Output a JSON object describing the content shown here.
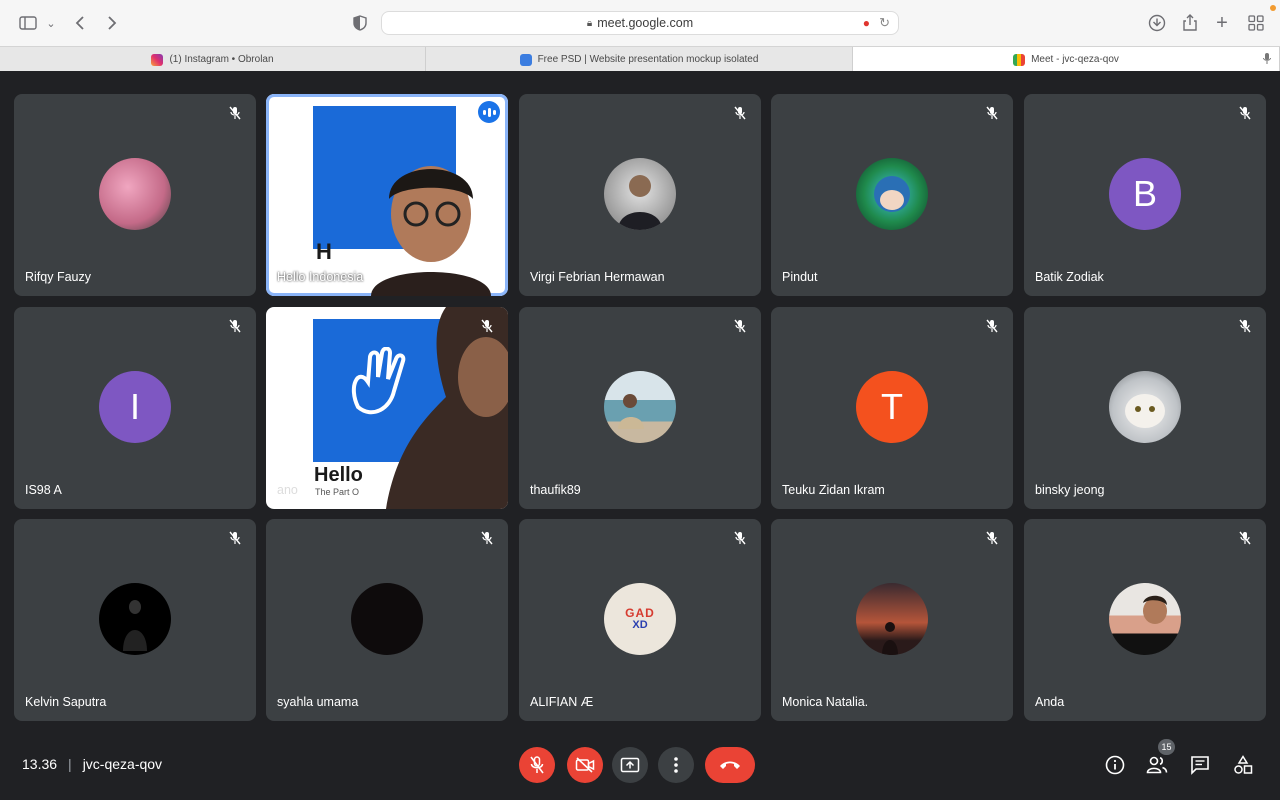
{
  "browser": {
    "url": "meet.google.com",
    "tabs": [
      {
        "label": "(1) Instagram • Obrolan"
      },
      {
        "label": "Free PSD | Website presentation mockup isolated"
      },
      {
        "label": "Meet - jvc-qeza-qov"
      }
    ]
  },
  "participants": [
    {
      "name": "Rifqy Fauzy",
      "avatar_color": "#d87fa0"
    },
    {
      "name": "Hello Indonesia",
      "sign_text": "H"
    },
    {
      "name": "Virgi Febrian Hermawan",
      "avatar_color": "#c9c9c9"
    },
    {
      "name": "Pindut",
      "avatar_color": "#1f8a4c"
    },
    {
      "name": "Batik Zodiak",
      "initial": "B",
      "avatar_color": "#7e57c2"
    },
    {
      "name": "IS98 A",
      "initial": "I",
      "avatar_color": "#7e57c2"
    },
    {
      "name": "ano",
      "sign_text": "Hello",
      "sign_sub": "The Part O"
    },
    {
      "name": "thaufik89",
      "avatar_color": "#8fb8c4"
    },
    {
      "name": "Teuku Zidan Ikram",
      "initial": "T",
      "avatar_color": "#f4511e"
    },
    {
      "name": "binsky jeong",
      "avatar_color": "#bfc3c7"
    },
    {
      "name": "Kelvin Saputra",
      "avatar_color": "#000000"
    },
    {
      "name": "syahla umama",
      "avatar_color": "#0e0b0c"
    },
    {
      "name": "ALIFIAN Æ",
      "avatar_text_top": "GAD",
      "avatar_text_bottom": "XD",
      "avatar_color": "#ece6dc"
    },
    {
      "name": "Monica Natalia.",
      "avatar_color": "#b5553a"
    },
    {
      "name": "Anda",
      "avatar_color": "#d9a08a"
    }
  ],
  "footer": {
    "time": "13.36",
    "meeting_code": "jvc-qeza-qov",
    "people_count": "15"
  },
  "colors": {
    "background": "#202124",
    "tile": "#3c4043",
    "danger": "#ea4335",
    "speaking_outline": "#8ab4f8"
  }
}
